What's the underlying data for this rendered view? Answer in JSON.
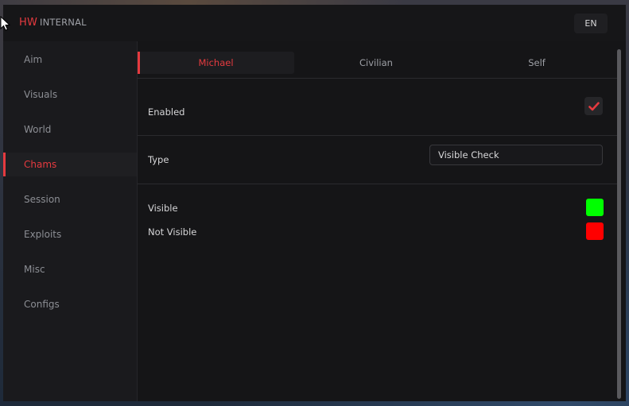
{
  "header": {
    "brand_primary": "HW",
    "brand_secondary": "INTERNAL",
    "language": "EN"
  },
  "sidebar": {
    "items": [
      {
        "label": "Aim",
        "active": false
      },
      {
        "label": "Visuals",
        "active": false
      },
      {
        "label": "World",
        "active": false
      },
      {
        "label": "Chams",
        "active": true
      },
      {
        "label": "Session",
        "active": false
      },
      {
        "label": "Exploits",
        "active": false
      },
      {
        "label": "Misc",
        "active": false
      },
      {
        "label": "Configs",
        "active": false
      }
    ]
  },
  "tabs": [
    {
      "label": "Michael",
      "active": true
    },
    {
      "label": "Civilian",
      "active": false
    },
    {
      "label": "Self",
      "active": false
    }
  ],
  "settings": {
    "enabled_label": "Enabled",
    "enabled_value": true,
    "type_label": "Type",
    "type_value": "Visible Check",
    "visible_label": "Visible",
    "visible_color": "#00ff00",
    "not_visible_label": "Not Visible",
    "not_visible_color": "#ff0000"
  },
  "theme": {
    "accent": "#e53a3f",
    "checkmark_icon": "checkmark-icon"
  }
}
